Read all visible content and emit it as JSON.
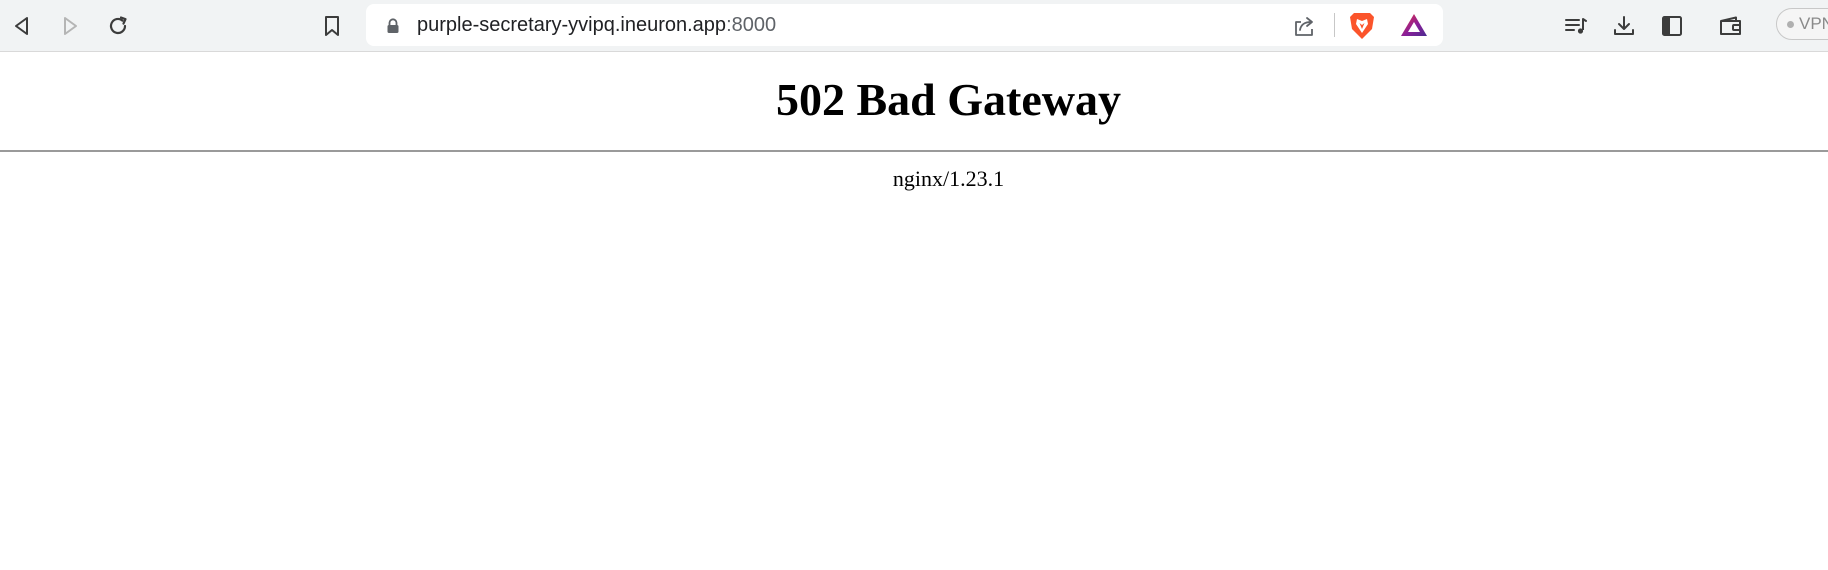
{
  "browser": {
    "address_bar": {
      "host": "purple-secretary-yvipq.ineuron.app",
      "port": ":8000"
    },
    "vpn_label": "VPN",
    "icons": {
      "back": "back-icon",
      "forward": "forward-icon",
      "reload": "reload-icon",
      "bookmark": "bookmark-icon",
      "lock": "lock-icon",
      "share": "share-icon",
      "brave_shields": "brave-shields-icon",
      "brave_rewards": "brave-rewards-icon",
      "playlist": "playlist-icon",
      "downloads": "download-icon",
      "sidebar": "sidebar-icon",
      "wallet": "wallet-icon"
    },
    "colors": {
      "toolbar_bg": "#f1f3f4",
      "brave_orange": "#fb542b",
      "rewards_gradient": [
        "#e8323f",
        "#8a1e99",
        "#4b2c91"
      ]
    }
  },
  "page": {
    "title": "502 Bad Gateway",
    "server": "nginx/1.23.1"
  }
}
